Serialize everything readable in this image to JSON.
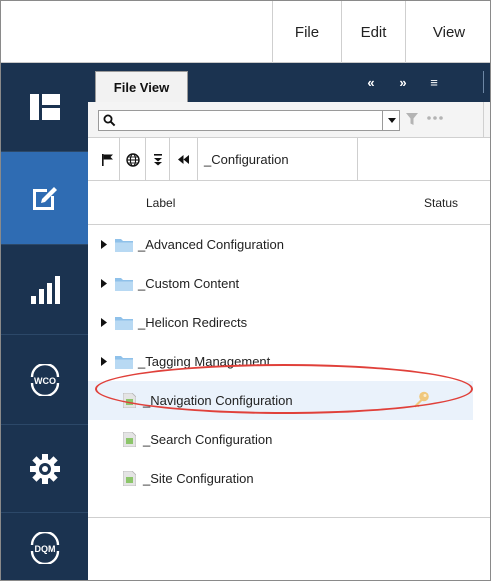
{
  "menubar": {
    "items": [
      "File",
      "Edit",
      "View"
    ]
  },
  "nav_rail": {
    "items": [
      {
        "icon": "dashboard-icon",
        "active": false
      },
      {
        "icon": "edit-icon",
        "active": true
      },
      {
        "icon": "reports-icon",
        "active": false
      },
      {
        "icon": "wco-icon",
        "label": "WCO",
        "active": false
      },
      {
        "icon": "settings-icon",
        "active": false
      },
      {
        "icon": "dqm-icon",
        "label": "DQM",
        "active": false
      }
    ],
    "active_color": "#2f6cb3",
    "bg_color": "#1b3350"
  },
  "panel": {
    "tab_label": "File View",
    "header_buttons": [
      "«",
      "»",
      "≡"
    ]
  },
  "search": {
    "value": "",
    "placeholder": ""
  },
  "toolbar": {
    "breadcrumb": "_Configuration"
  },
  "columns": {
    "label": "Label",
    "status": "Status"
  },
  "tree": {
    "rows": [
      {
        "type": "folder",
        "label": "_Advanced Configuration"
      },
      {
        "type": "folder",
        "label": "_Custom Content"
      },
      {
        "type": "folder",
        "label": "_Helicon Redirects"
      },
      {
        "type": "folder",
        "label": "_Tagging Management"
      },
      {
        "type": "file",
        "label": "_Navigation Configuration",
        "selected": true,
        "status_icon": "key-icon"
      },
      {
        "type": "file",
        "label": "_Search Configuration"
      },
      {
        "type": "file",
        "label": "_Site Configuration"
      }
    ]
  },
  "highlight_color": "#e0403a"
}
